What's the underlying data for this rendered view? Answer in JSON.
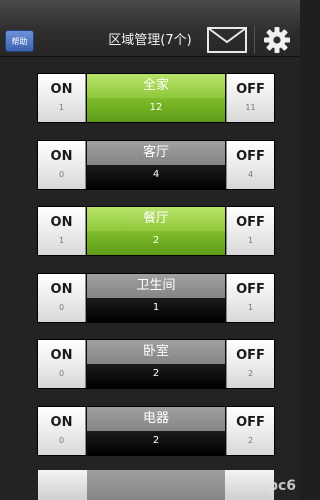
{
  "header": {
    "help_label": "帮助",
    "title": "区域管理(7个)",
    "mail_icon": "mail-icon",
    "settings_icon": "gear-icon"
  },
  "zones": [
    {
      "on_label": "ON",
      "on_count": "1",
      "name": "全家",
      "total": "12",
      "off_label": "OFF",
      "off_count": "11",
      "active": true
    },
    {
      "on_label": "ON",
      "on_count": "0",
      "name": "客厅",
      "total": "4",
      "off_label": "OFF",
      "off_count": "4",
      "active": false
    },
    {
      "on_label": "ON",
      "on_count": "1",
      "name": "餐厅",
      "total": "2",
      "off_label": "OFF",
      "off_count": "1",
      "active": true
    },
    {
      "on_label": "ON",
      "on_count": "0",
      "name": "卫生间",
      "total": "1",
      "off_label": "OFF",
      "off_count": "1",
      "active": false
    },
    {
      "on_label": "ON",
      "on_count": "0",
      "name": "卧室",
      "total": "2",
      "off_label": "OFF",
      "off_count": "2",
      "active": false
    },
    {
      "on_label": "ON",
      "on_count": "0",
      "name": "电器",
      "total": "2",
      "off_label": "OFF",
      "off_count": "2",
      "active": false
    }
  ],
  "watermark_text": "pc6"
}
